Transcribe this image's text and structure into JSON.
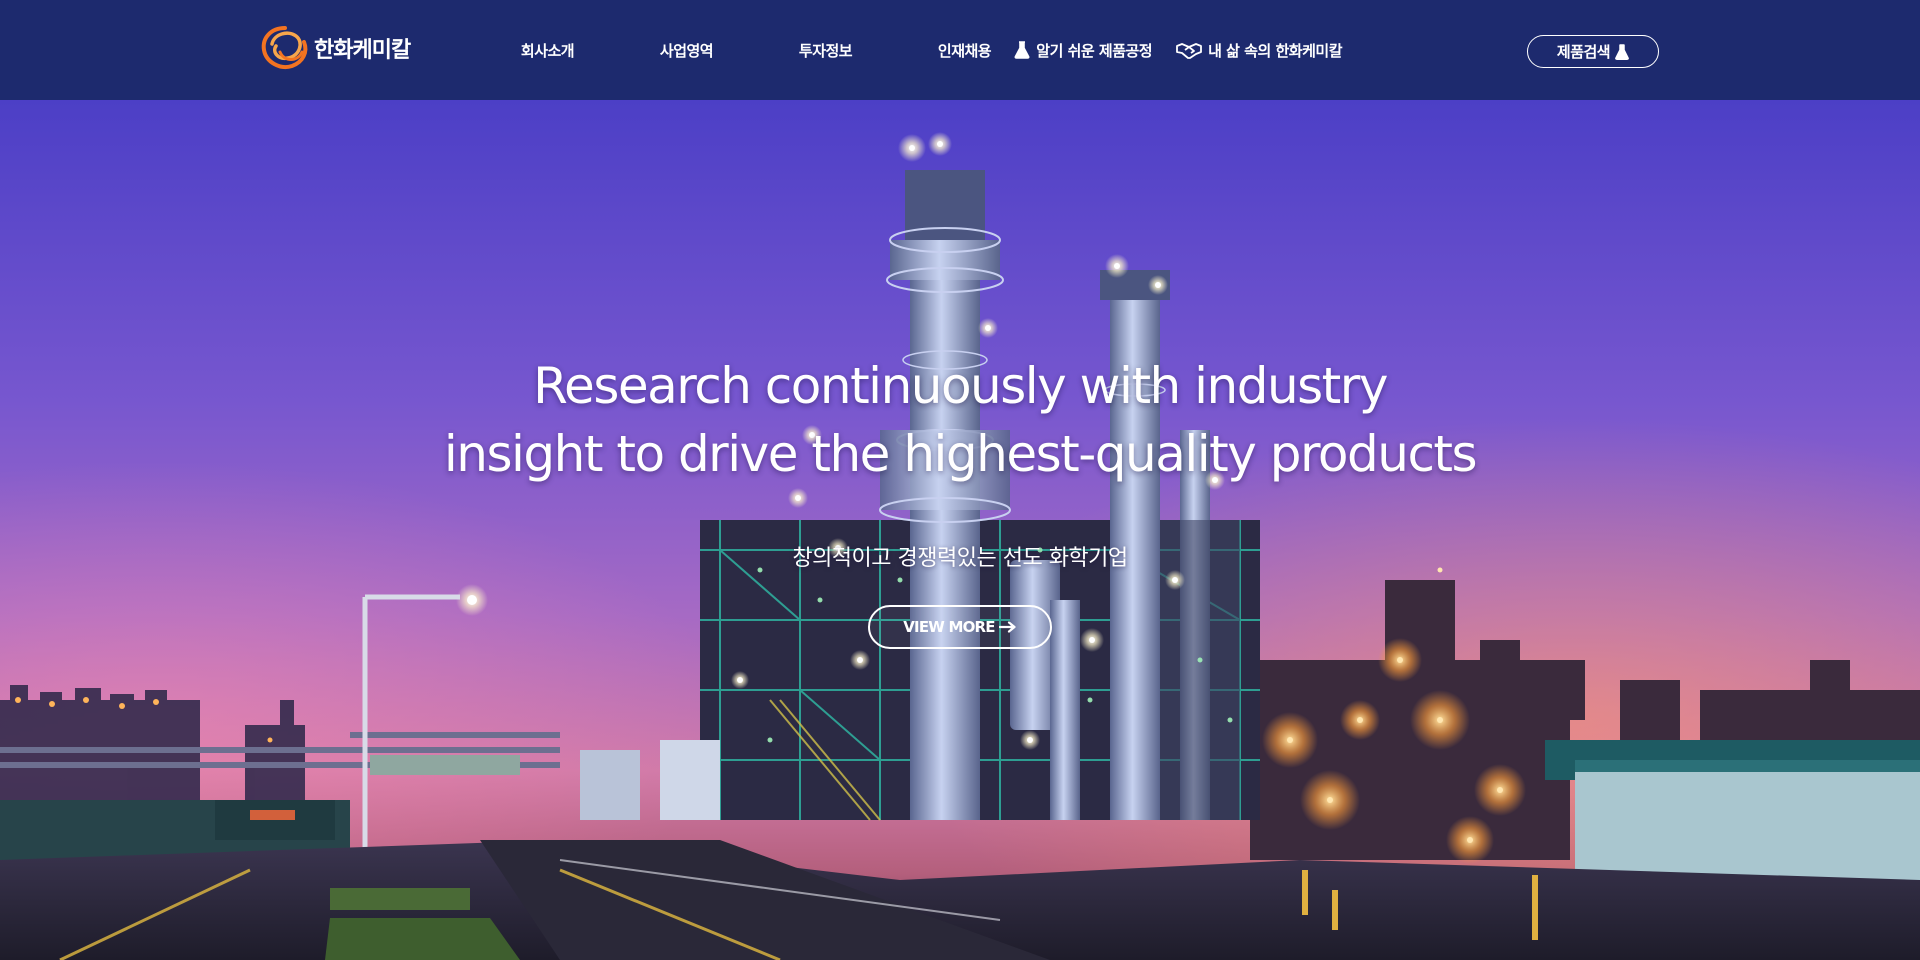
{
  "brand": {
    "name": "한화케미칼",
    "logo_icon": "hanwha-swirl-logo",
    "colors": {
      "logo_orange": "#f37321",
      "header_bg": "#1d2a6e"
    }
  },
  "nav": {
    "items": [
      {
        "label": "회사소개"
      },
      {
        "label": "사업영역"
      },
      {
        "label": "투자정보"
      },
      {
        "label": "인재채용"
      }
    ]
  },
  "util": {
    "process_label": "알기 쉬운 제품공정",
    "process_icon": "flask-icon",
    "life_label": "내 삶 속의 한화케미칼",
    "life_icon": "handshake-icon",
    "search_label": "제품검색",
    "search_icon": "flask-icon"
  },
  "hero": {
    "title_line1": "Research continuously with industry",
    "title_line2": "insight to drive the highest-quality products",
    "subtitle": "창의적이고 경쟁력있는 선도 화학기업",
    "cta_label": "VIEW MORE",
    "cta_icon": "arrow-right-icon"
  }
}
